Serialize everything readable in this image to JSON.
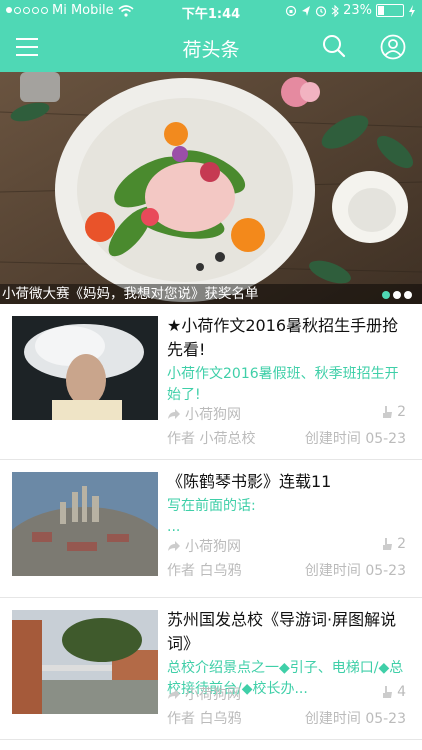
{
  "status_bar": {
    "carrier": "Mi Mobile",
    "time": "下午1:44",
    "battery": "23%",
    "battery_level": 0.23
  },
  "nav": {
    "title": "荷头条",
    "menu_icon": "hamburger-menu-icon",
    "search_icon": "search-icon",
    "user_icon": "user-icon"
  },
  "banner": {
    "caption": "小荷微大赛《妈妈，我想对您说》获奖名单",
    "page_count": 3,
    "active_page": 1
  },
  "articles": [
    {
      "headline": "★小荷作文2016暑秋招生手册抢先看!",
      "summary": "小荷作文2016暑假班、秋季班招生开始了!",
      "source": "小荷狗网",
      "likes": "2",
      "author_label": "作者",
      "author": "小荷总校",
      "created_label": "创建时间",
      "created": "05-23"
    },
    {
      "headline": "《陈鹤琴书影》连载11",
      "summary": "写在前面的话:\n...",
      "source": "小荷狗网",
      "likes": "2",
      "author_label": "作者",
      "author": "白乌鸦",
      "created_label": "创建时间",
      "created": "05-23"
    },
    {
      "headline": "苏州国发总校《导游词·屏图解说词》",
      "summary": "总校介绍景点之一◆引子、电梯口/◆总校接待前台/◆校长办...",
      "source": "小荷狗网",
      "likes": "4",
      "author_label": "作者",
      "author": "白乌鸦",
      "created_label": "创建时间",
      "created": "05-23"
    }
  ],
  "colors": {
    "accent": "#4fd8b5",
    "summary_text": "#3fcfa8",
    "meta_text": "#bbbbbb"
  }
}
